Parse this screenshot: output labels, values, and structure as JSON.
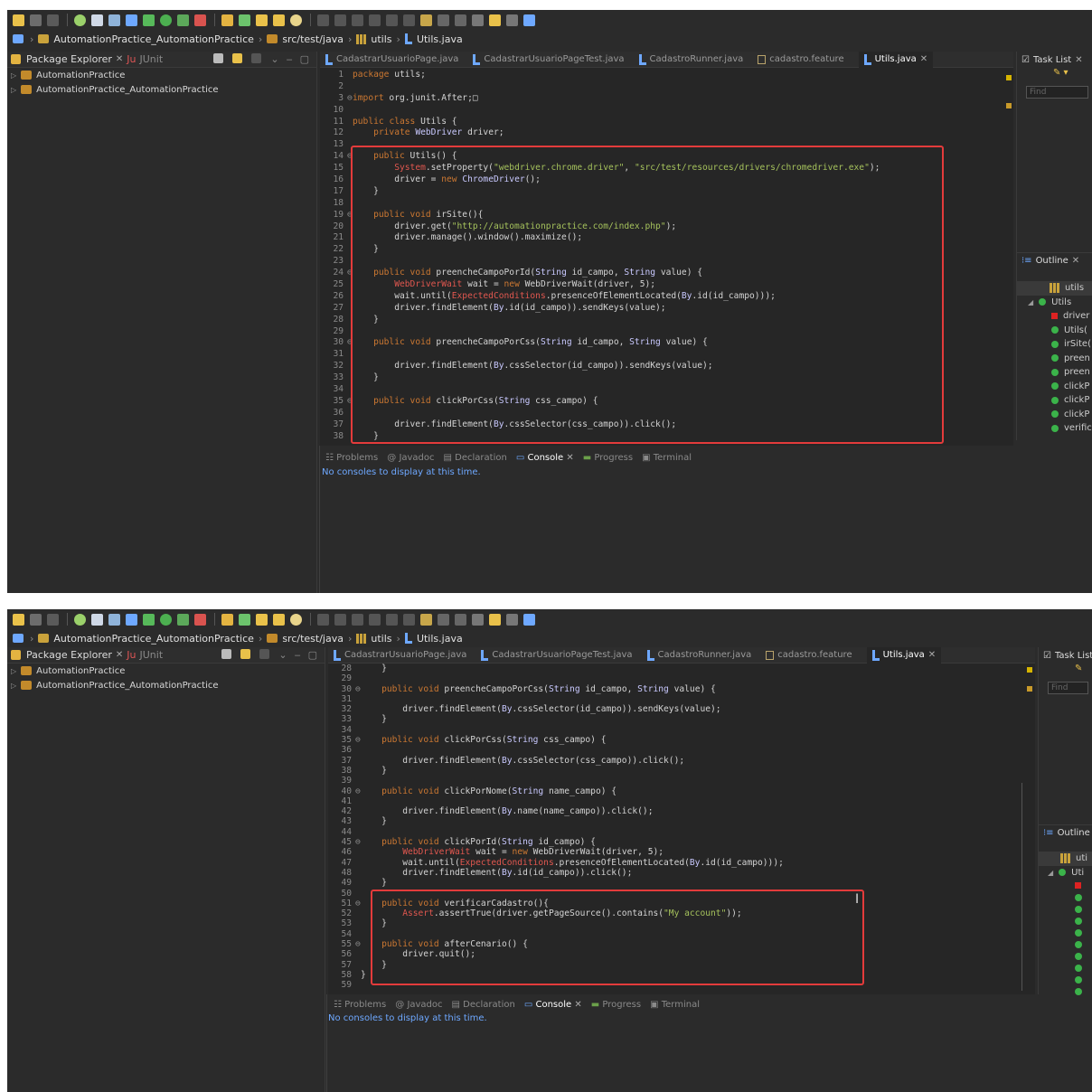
{
  "colors": {
    "highlight": "#e33b3b",
    "keyword": "#cc7832",
    "string": "#a5c25c",
    "link": "#6ea8ff"
  },
  "breadcrumb": {
    "project": "AutomationPractice_AutomationPractice",
    "folder": "src/test/java",
    "package": "utils",
    "file": "Utils.java"
  },
  "left": {
    "tab_package_explorer": "Package Explorer",
    "tab_junit": "JUnit",
    "tree": [
      "AutomationPractice",
      "AutomationPractice_AutomationPractice"
    ]
  },
  "editor_tabs": [
    "CadastrarUsuarioPage.java",
    "CadastrarUsuarioPageTest.java",
    "CadastroRunner.java",
    "cadastro.feature",
    "Utils.java"
  ],
  "bottom": {
    "tabs": [
      "Problems",
      "Javadoc",
      "Declaration",
      "Console",
      "Progress",
      "Terminal"
    ],
    "active": "Console",
    "message": "No consoles to display at this time."
  },
  "right": {
    "task_list": "Task List",
    "find_placeholder": "Find",
    "outline": "Outline",
    "outline_items_top": [
      "utils",
      "Utils",
      "driver",
      "Utils(",
      "irSite(",
      "preen",
      "preen",
      "clickP",
      "clickP",
      "clickP",
      "verific"
    ],
    "outline_items_bottom": [
      "uti",
      "Uti"
    ]
  },
  "code_top": [
    [
      "1",
      "package utils;"
    ],
    [
      "2",
      ""
    ],
    [
      "3",
      "import org.junit.After;□"
    ],
    [
      "10",
      ""
    ],
    [
      "11",
      "public class Utils {"
    ],
    [
      "12",
      "    private WebDriver driver;"
    ],
    [
      "13",
      ""
    ],
    [
      "14",
      "    public Utils() {"
    ],
    [
      "15",
      "        System.setProperty(\"webdriver.chrome.driver\", \"src/test/resources/drivers/chromedriver.exe\");"
    ],
    [
      "16",
      "        driver = new ChromeDriver();"
    ],
    [
      "17",
      "    }"
    ],
    [
      "18",
      ""
    ],
    [
      "19",
      "    public void irSite(){"
    ],
    [
      "20",
      "        driver.get(\"http://automationpractice.com/index.php\");"
    ],
    [
      "21",
      "        driver.manage().window().maximize();"
    ],
    [
      "22",
      "    }"
    ],
    [
      "23",
      ""
    ],
    [
      "24",
      "    public void preencheCampoPorId(String id_campo, String value) {"
    ],
    [
      "25",
      "        WebDriverWait wait = new WebDriverWait(driver, 5);"
    ],
    [
      "26",
      "        wait.until(ExpectedConditions.presenceOfElementLocated(By.id(id_campo)));"
    ],
    [
      "27",
      "        driver.findElement(By.id(id_campo)).sendKeys(value);"
    ],
    [
      "28",
      "    }"
    ],
    [
      "29",
      ""
    ],
    [
      "30",
      "    public void preencheCampoPorCss(String id_campo, String value) {"
    ],
    [
      "31",
      ""
    ],
    [
      "32",
      "        driver.findElement(By.cssSelector(id_campo)).sendKeys(value);"
    ],
    [
      "33",
      "    }"
    ],
    [
      "34",
      ""
    ],
    [
      "35",
      "    public void clickPorCss(String css_campo) {"
    ],
    [
      "36",
      ""
    ],
    [
      "37",
      "        driver.findElement(By.cssSelector(css_campo)).click();"
    ],
    [
      "38",
      "    }"
    ]
  ],
  "code_bottom": [
    [
      "28",
      "    }"
    ],
    [
      "29",
      ""
    ],
    [
      "30",
      "    public void preencheCampoPorCss(String id_campo, String value) {"
    ],
    [
      "31",
      ""
    ],
    [
      "32",
      "        driver.findElement(By.cssSelector(id_campo)).sendKeys(value);"
    ],
    [
      "33",
      "    }"
    ],
    [
      "34",
      ""
    ],
    [
      "35",
      "    public void clickPorCss(String css_campo) {"
    ],
    [
      "36",
      ""
    ],
    [
      "37",
      "        driver.findElement(By.cssSelector(css_campo)).click();"
    ],
    [
      "38",
      "    }"
    ],
    [
      "39",
      ""
    ],
    [
      "40",
      "    public void clickPorNome(String name_campo) {"
    ],
    [
      "41",
      ""
    ],
    [
      "42",
      "        driver.findElement(By.name(name_campo)).click();"
    ],
    [
      "43",
      "    }"
    ],
    [
      "44",
      ""
    ],
    [
      "45",
      "    public void clickPorId(String id_campo) {"
    ],
    [
      "46",
      "        WebDriverWait wait = new WebDriverWait(driver, 5);"
    ],
    [
      "47",
      "        wait.until(ExpectedConditions.presenceOfElementLocated(By.id(id_campo)));"
    ],
    [
      "48",
      "        driver.findElement(By.id(id_campo)).click();"
    ],
    [
      "49",
      "    }"
    ],
    [
      "50",
      ""
    ],
    [
      "51",
      "    public void verificarCadastro(){"
    ],
    [
      "52",
      "        Assert.assertTrue(driver.getPageSource().contains(\"My account\"));"
    ],
    [
      "53",
      "    }"
    ],
    [
      "54",
      ""
    ],
    [
      "55",
      "    public void afterCenario() {"
    ],
    [
      "56",
      "        driver.quit();"
    ],
    [
      "57",
      "    }"
    ],
    [
      "58",
      "}"
    ],
    [
      "59",
      ""
    ]
  ]
}
